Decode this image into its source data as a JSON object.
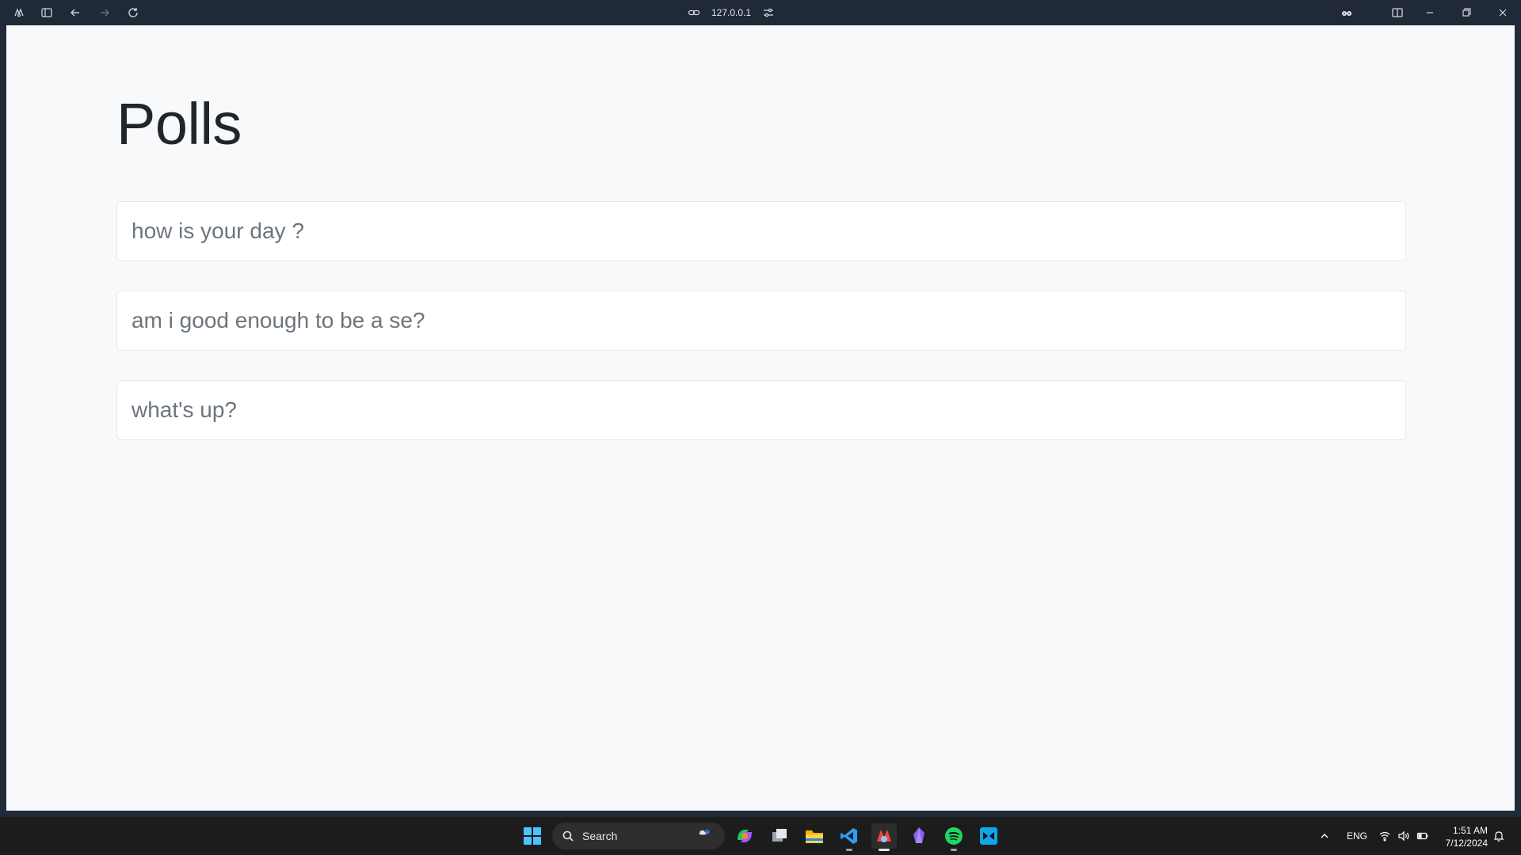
{
  "browser": {
    "address": "127.0.0.1"
  },
  "page": {
    "title": "Polls",
    "polls": [
      {
        "question": "how is your day ?"
      },
      {
        "question": "am i good enough to be a se?"
      },
      {
        "question": "what's up?"
      }
    ]
  },
  "taskbar": {
    "search_label": "Search",
    "language": "ENG",
    "time": "1:51 AM",
    "date": "7/12/2024"
  },
  "colors": {
    "page_background": "#f8f9fa",
    "title_text": "#212529",
    "poll_text": "#6c757d",
    "chrome_background": "#1f2937",
    "taskbar_background": "#1c1c1c"
  }
}
